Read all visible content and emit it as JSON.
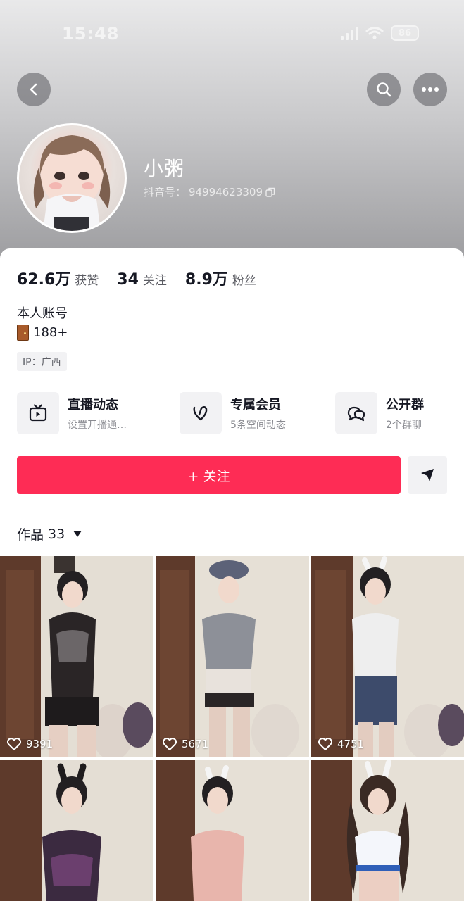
{
  "status_bar": {
    "time": "15:48",
    "battery": "86"
  },
  "nav": {
    "back_icon": "chevron-left-icon",
    "search_icon": "search-icon",
    "more_icon": "more-icon"
  },
  "profile": {
    "nickname": "小粥",
    "douyin_id_label": "抖音号：",
    "douyin_id": "94994623309"
  },
  "stats": [
    {
      "value": "62.6万",
      "label": "获赞"
    },
    {
      "value": "34",
      "label": "关注"
    },
    {
      "value": "8.9万",
      "label": "粉丝"
    }
  ],
  "bio": {
    "line1": "本人账号",
    "line2": "188+"
  },
  "ip_tag": "IP：广西",
  "features": [
    {
      "title": "直播动态",
      "subtitle": "设置开播通…",
      "icon": "tv-icon"
    },
    {
      "title": "专属会员",
      "subtitle": "5条空间动态",
      "icon": "heart-v-icon"
    },
    {
      "title": "公开群",
      "subtitle": "2个群聊",
      "icon": "chat-bubbles-icon"
    }
  ],
  "follow_button": "+ 关注",
  "works_tab": {
    "label": "作品",
    "count": "33"
  },
  "videos": [
    {
      "likes": "9391"
    },
    {
      "likes": "5671"
    },
    {
      "likes": "4751"
    },
    {
      "likes": ""
    },
    {
      "likes": ""
    },
    {
      "likes": ""
    }
  ],
  "colors": {
    "accent": "#fe2c55",
    "text": "#161823",
    "secondary": "#5b5c63"
  }
}
